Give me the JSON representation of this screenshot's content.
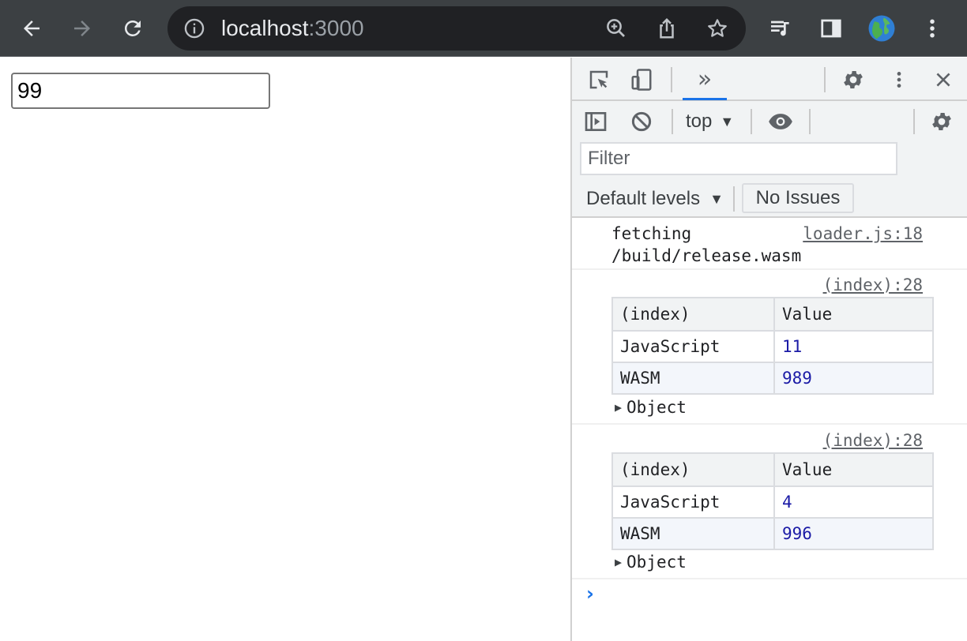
{
  "browser": {
    "url_host": "localhost",
    "url_port": ":3000",
    "icons": [
      "back-arrow-icon",
      "forward-arrow-icon",
      "reload-icon",
      "site-info-icon",
      "zoom-icon",
      "share-icon",
      "bookmark-star-icon",
      "media-control-icon",
      "side-panel-icon",
      "profile-avatar-icon",
      "menu-kebab-icon"
    ]
  },
  "page": {
    "input_value": "99"
  },
  "devtools": {
    "more_tabs_label": "»",
    "context": "top",
    "filter_placeholder": "Filter",
    "levels_label": "Default levels",
    "issues_label": "No Issues",
    "colors": {
      "accent": "#1a73e8",
      "number": "#1a1aa6",
      "link": "#5f6368"
    }
  },
  "console": {
    "log1": {
      "text": "fetching\n/build/release.wasm",
      "source": "loader.js:18"
    },
    "tables": [
      {
        "source": "(index):28",
        "headers": [
          "(index)",
          "Value"
        ],
        "rows": [
          {
            "key": "JavaScript",
            "value": "11"
          },
          {
            "key": "WASM",
            "value": "989"
          }
        ],
        "object_label": "Object"
      },
      {
        "source": "(index):28",
        "headers": [
          "(index)",
          "Value"
        ],
        "rows": [
          {
            "key": "JavaScript",
            "value": "4"
          },
          {
            "key": "WASM",
            "value": "996"
          }
        ],
        "object_label": "Object"
      }
    ],
    "prompt": "›"
  }
}
